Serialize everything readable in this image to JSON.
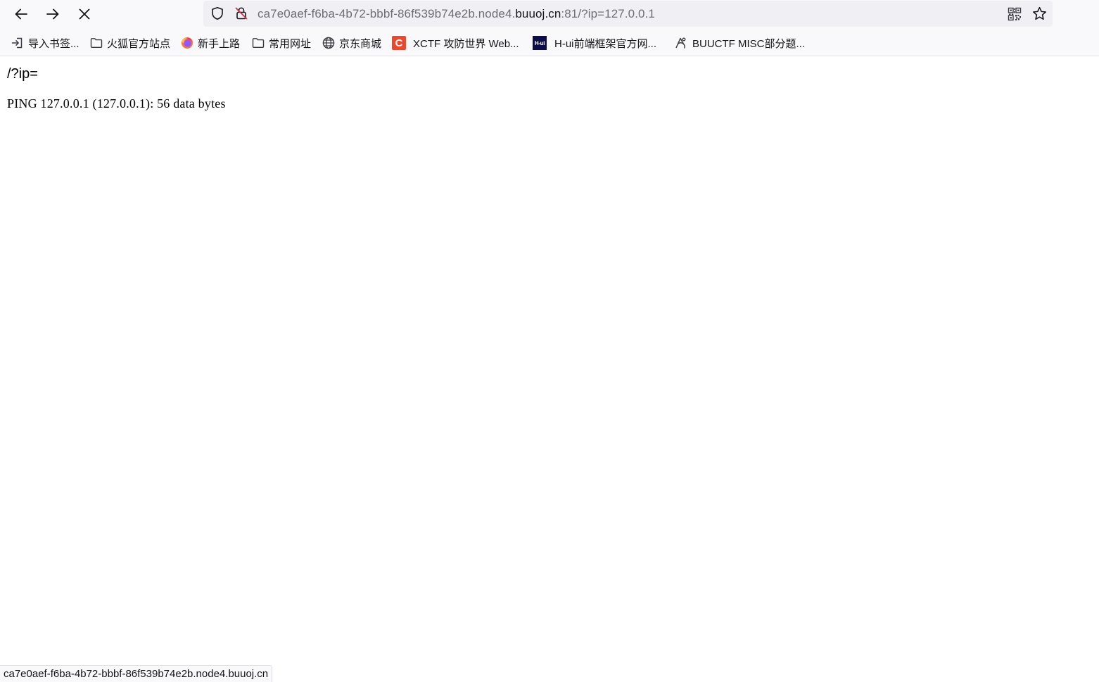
{
  "toolbar": {
    "back_icon": "arrow-left-icon",
    "forward_icon": "arrow-right-icon",
    "stop_icon": "stop-loading-x-icon"
  },
  "urlbar": {
    "url_prefix": "ca7e0aef-f6ba-4b72-bbbf-86f539b74e2b.node4.",
    "url_domain": "buuoj.cn",
    "url_suffix": ":81/?ip=127.0.0.1",
    "shield_icon": "tracking-protection-shield-icon",
    "lock_icon": "insecure-lock-icon",
    "qr_icon": "qr-code-icon",
    "star_icon": "bookmark-star-icon"
  },
  "bookmarks": [
    {
      "label": "导入书签...",
      "icon": "import-icon"
    },
    {
      "label": "火狐官方站点",
      "icon": "folder-icon"
    },
    {
      "label": "新手上路",
      "icon": "firefox-icon"
    },
    {
      "label": "常用网址",
      "icon": "folder-icon"
    },
    {
      "label": "京东商城",
      "icon": "globe-icon"
    },
    {
      "label": "XCTF 攻防世界 Web...",
      "icon": "xctf-icon",
      "badge": "C"
    },
    {
      "label": "H-ui前端框架官方网...",
      "icon": "hui-icon",
      "badge": "H-ui"
    },
    {
      "label": "BUUCTF MISC部分题...",
      "icon": "buuctf-icon"
    }
  ],
  "page": {
    "query_text": "/?ip=",
    "output_text": "PING 127.0.0.1 (127.0.0.1): 56 data bytes"
  },
  "statusbar": {
    "text": "ca7e0aef-f6ba-4b72-bbbf-86f539b74e2b.node4.buuoj.cn"
  },
  "colors": {
    "toolbar_bg": "#f9f9fb",
    "urlbar_bg": "#f0f0f4",
    "xctf_badge": "#e94a2d",
    "hui_badge": "#0c0c4a",
    "lock_slash": "#e22850"
  }
}
